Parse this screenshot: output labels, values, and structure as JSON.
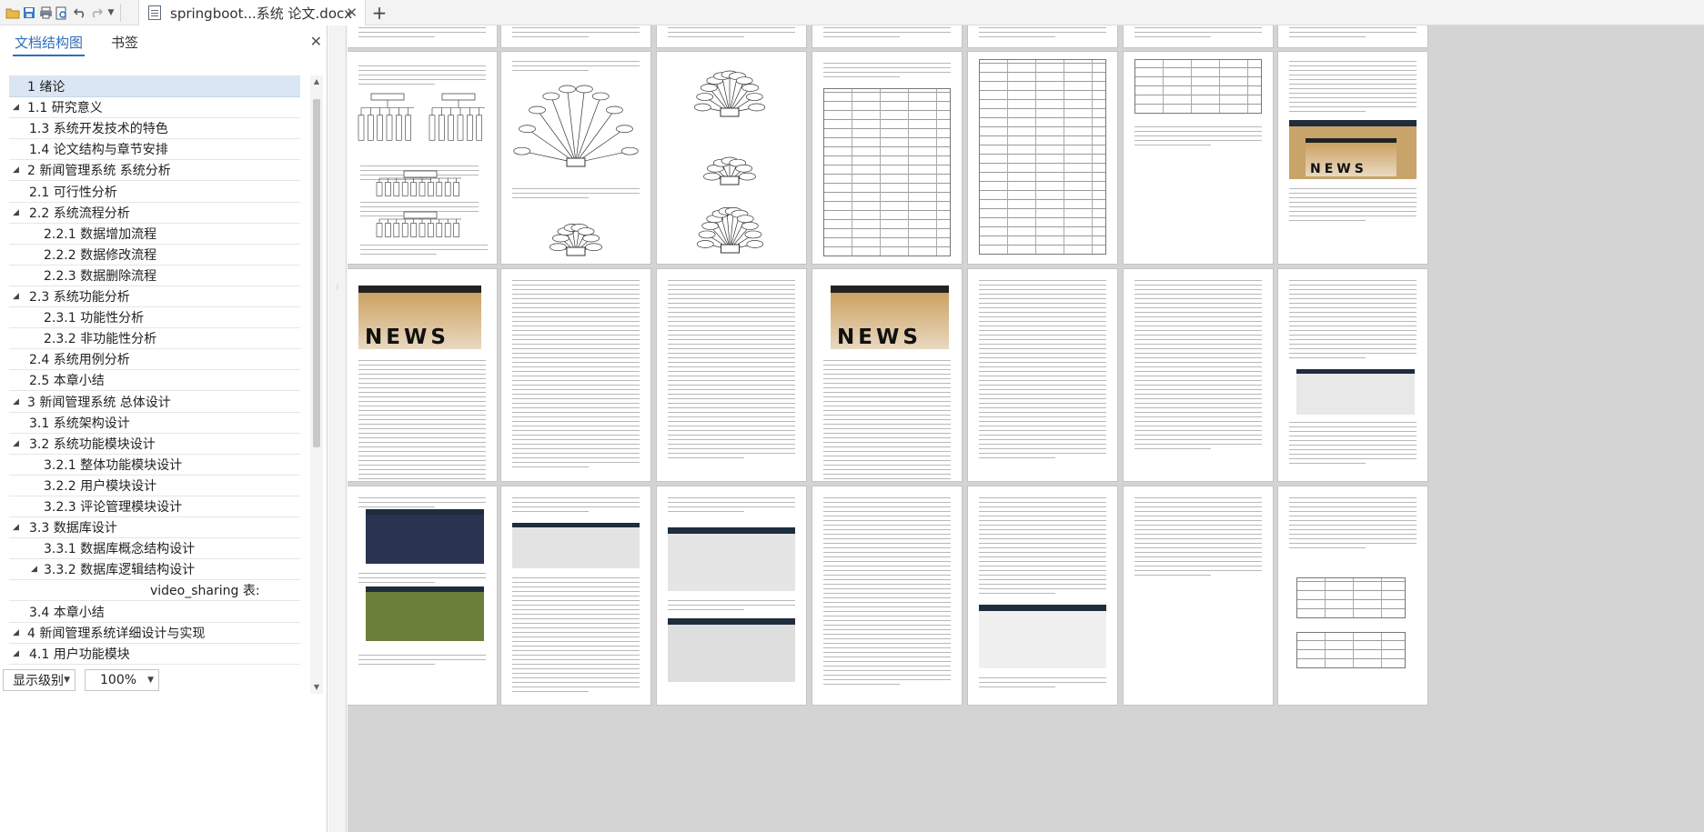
{
  "titlebar": {
    "doc_title": "springboot...系统 论文.docx",
    "new_tab_label": "+"
  },
  "left_panel": {
    "tabs": [
      "文档结构图",
      "书签"
    ],
    "outline": [
      {
        "label": "1 绪论",
        "level": 0,
        "expanded": null,
        "selected": true
      },
      {
        "label": "1.1 研究意义",
        "level": 0,
        "expanded": true,
        "selected": false
      },
      {
        "label": "1.3 系统开发技术的特色",
        "level": 1,
        "expanded": null,
        "selected": false
      },
      {
        "label": "1.4 论文结构与章节安排",
        "level": 1,
        "expanded": null,
        "selected": false
      },
      {
        "label": "2 新闻管理系统  系统分析",
        "level": 0,
        "expanded": true,
        "selected": false
      },
      {
        "label": "2.1 可行性分析",
        "level": 1,
        "expanded": null,
        "selected": false
      },
      {
        "label": "2.2 系统流程分析",
        "level": 1,
        "expanded": true,
        "selected": false
      },
      {
        "label": "2.2.1  数据增加流程",
        "level": 2,
        "expanded": null,
        "selected": false
      },
      {
        "label": "2.2.2  数据修改流程",
        "level": 2,
        "expanded": null,
        "selected": false
      },
      {
        "label": "2.2.3  数据删除流程",
        "level": 2,
        "expanded": null,
        "selected": false
      },
      {
        "label": "2.3  系统功能分析",
        "level": 1,
        "expanded": true,
        "selected": false
      },
      {
        "label": "2.3.1  功能性分析",
        "level": 2,
        "expanded": null,
        "selected": false
      },
      {
        "label": "2.3.2  非功能性分析",
        "level": 2,
        "expanded": null,
        "selected": false
      },
      {
        "label": "2.4  系统用例分析",
        "level": 1,
        "expanded": null,
        "selected": false
      },
      {
        "label": "2.5 本章小结",
        "level": 1,
        "expanded": null,
        "selected": false
      },
      {
        "label": "3  新闻管理系统  总体设计",
        "level": 0,
        "expanded": true,
        "selected": false
      },
      {
        "label": "3.1  系统架构设计",
        "level": 1,
        "expanded": null,
        "selected": false
      },
      {
        "label": "3.2  系统功能模块设计",
        "level": 1,
        "expanded": true,
        "selected": false
      },
      {
        "label": "3.2.1 整体功能模块设计",
        "level": 2,
        "expanded": null,
        "selected": false
      },
      {
        "label": "3.2.2 用户模块设计",
        "level": 2,
        "expanded": null,
        "selected": false
      },
      {
        "label": "3.2.3 评论管理模块设计",
        "level": 2,
        "expanded": null,
        "selected": false
      },
      {
        "label": "3.3  数据库设计",
        "level": 1,
        "expanded": true,
        "selected": false
      },
      {
        "label": "3.3.1  数据库概念结构设计",
        "level": 2,
        "expanded": null,
        "selected": false
      },
      {
        "label": "3.3.2  数据库逻辑结构设计",
        "level": 2,
        "expanded": true,
        "selected": false
      },
      {
        "label": "video_sharing 表:",
        "level": 4,
        "expanded": null,
        "selected": false
      },
      {
        "label": "3.4 本章小结",
        "level": 1,
        "expanded": null,
        "selected": false
      },
      {
        "label": "4  新闻管理系统详细设计与实现",
        "level": 0,
        "expanded": true,
        "selected": false
      },
      {
        "label": "4.1 用户功能模块",
        "level": 1,
        "expanded": true,
        "selected": false
      }
    ],
    "display_level_label": "显示级别",
    "zoom_value": "100%"
  },
  "icons": [
    "open-folder-icon",
    "save-icon",
    "print-icon",
    "print-preview-icon",
    "undo-icon",
    "redo-icon",
    "dropdown-icon",
    "document-icon",
    "close-icon"
  ],
  "colors": {
    "accent": "#2f6fb8",
    "selected_row": "#dbe6f4",
    "canvas": "#d4d4d4"
  }
}
